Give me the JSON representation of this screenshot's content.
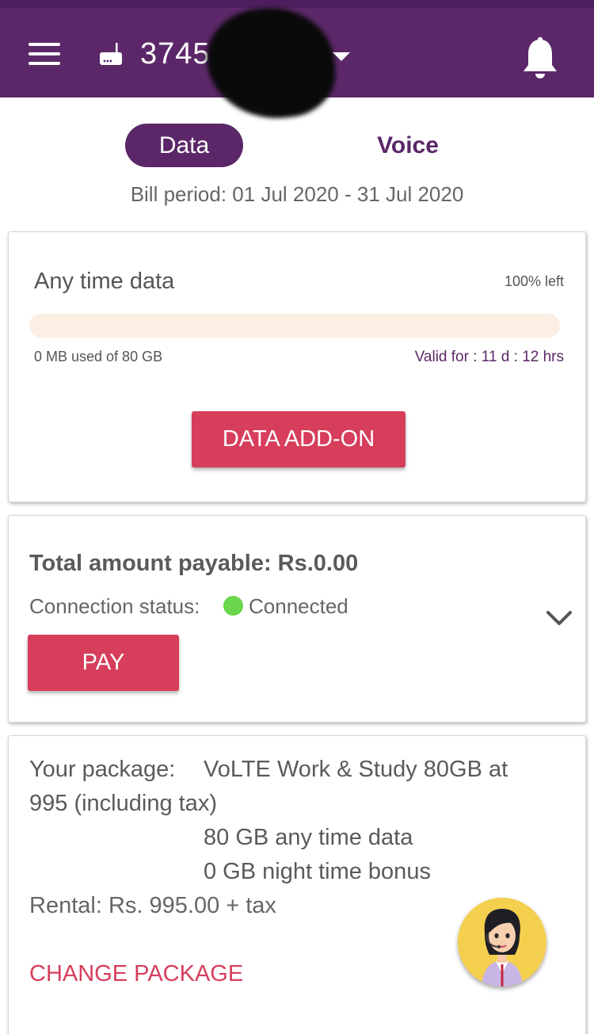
{
  "header": {
    "account_number": "374599434",
    "icons": {
      "menu": "hamburger-menu-icon",
      "router": "router-icon",
      "dropdown": "caret-down-icon",
      "notification": "bell-icon"
    }
  },
  "tabs": {
    "data_label": "Data",
    "voice_label": "Voice",
    "active": "Data"
  },
  "bill_period": "Bill period: 01 Jul 2020 - 31 Jul 2020",
  "usage_card": {
    "title": "Any time data",
    "percent_left": "100% left",
    "used_fraction": 0,
    "used_text": "0 MB used of 80 GB",
    "valid_text": "Valid for : 11 d : 12 hrs",
    "addon_button": "DATA ADD-ON"
  },
  "payment_card": {
    "total_payable": "Total amount payable: Rs.0.00",
    "connection_label": "Connection status:",
    "connection_value": "Connected",
    "pay_button": "PAY"
  },
  "package_card": {
    "label": "Your package:",
    "name_line_1": "VoLTE Work & Study 80GB at",
    "name_line_2": "995 (including tax)",
    "feature_1": "80 GB any time data",
    "feature_2": "0 GB night time bonus",
    "rental": "Rental: Rs. 995.00 + tax",
    "change_button": "CHANGE PACKAGE"
  },
  "colors": {
    "brand_purple": "#5b2768",
    "accent_red": "#d63e5c",
    "status_green": "#6bd64b",
    "fab_yellow": "#f5cf4e"
  },
  "assistant": {
    "icon": "virtual-assistant-avatar-icon"
  }
}
